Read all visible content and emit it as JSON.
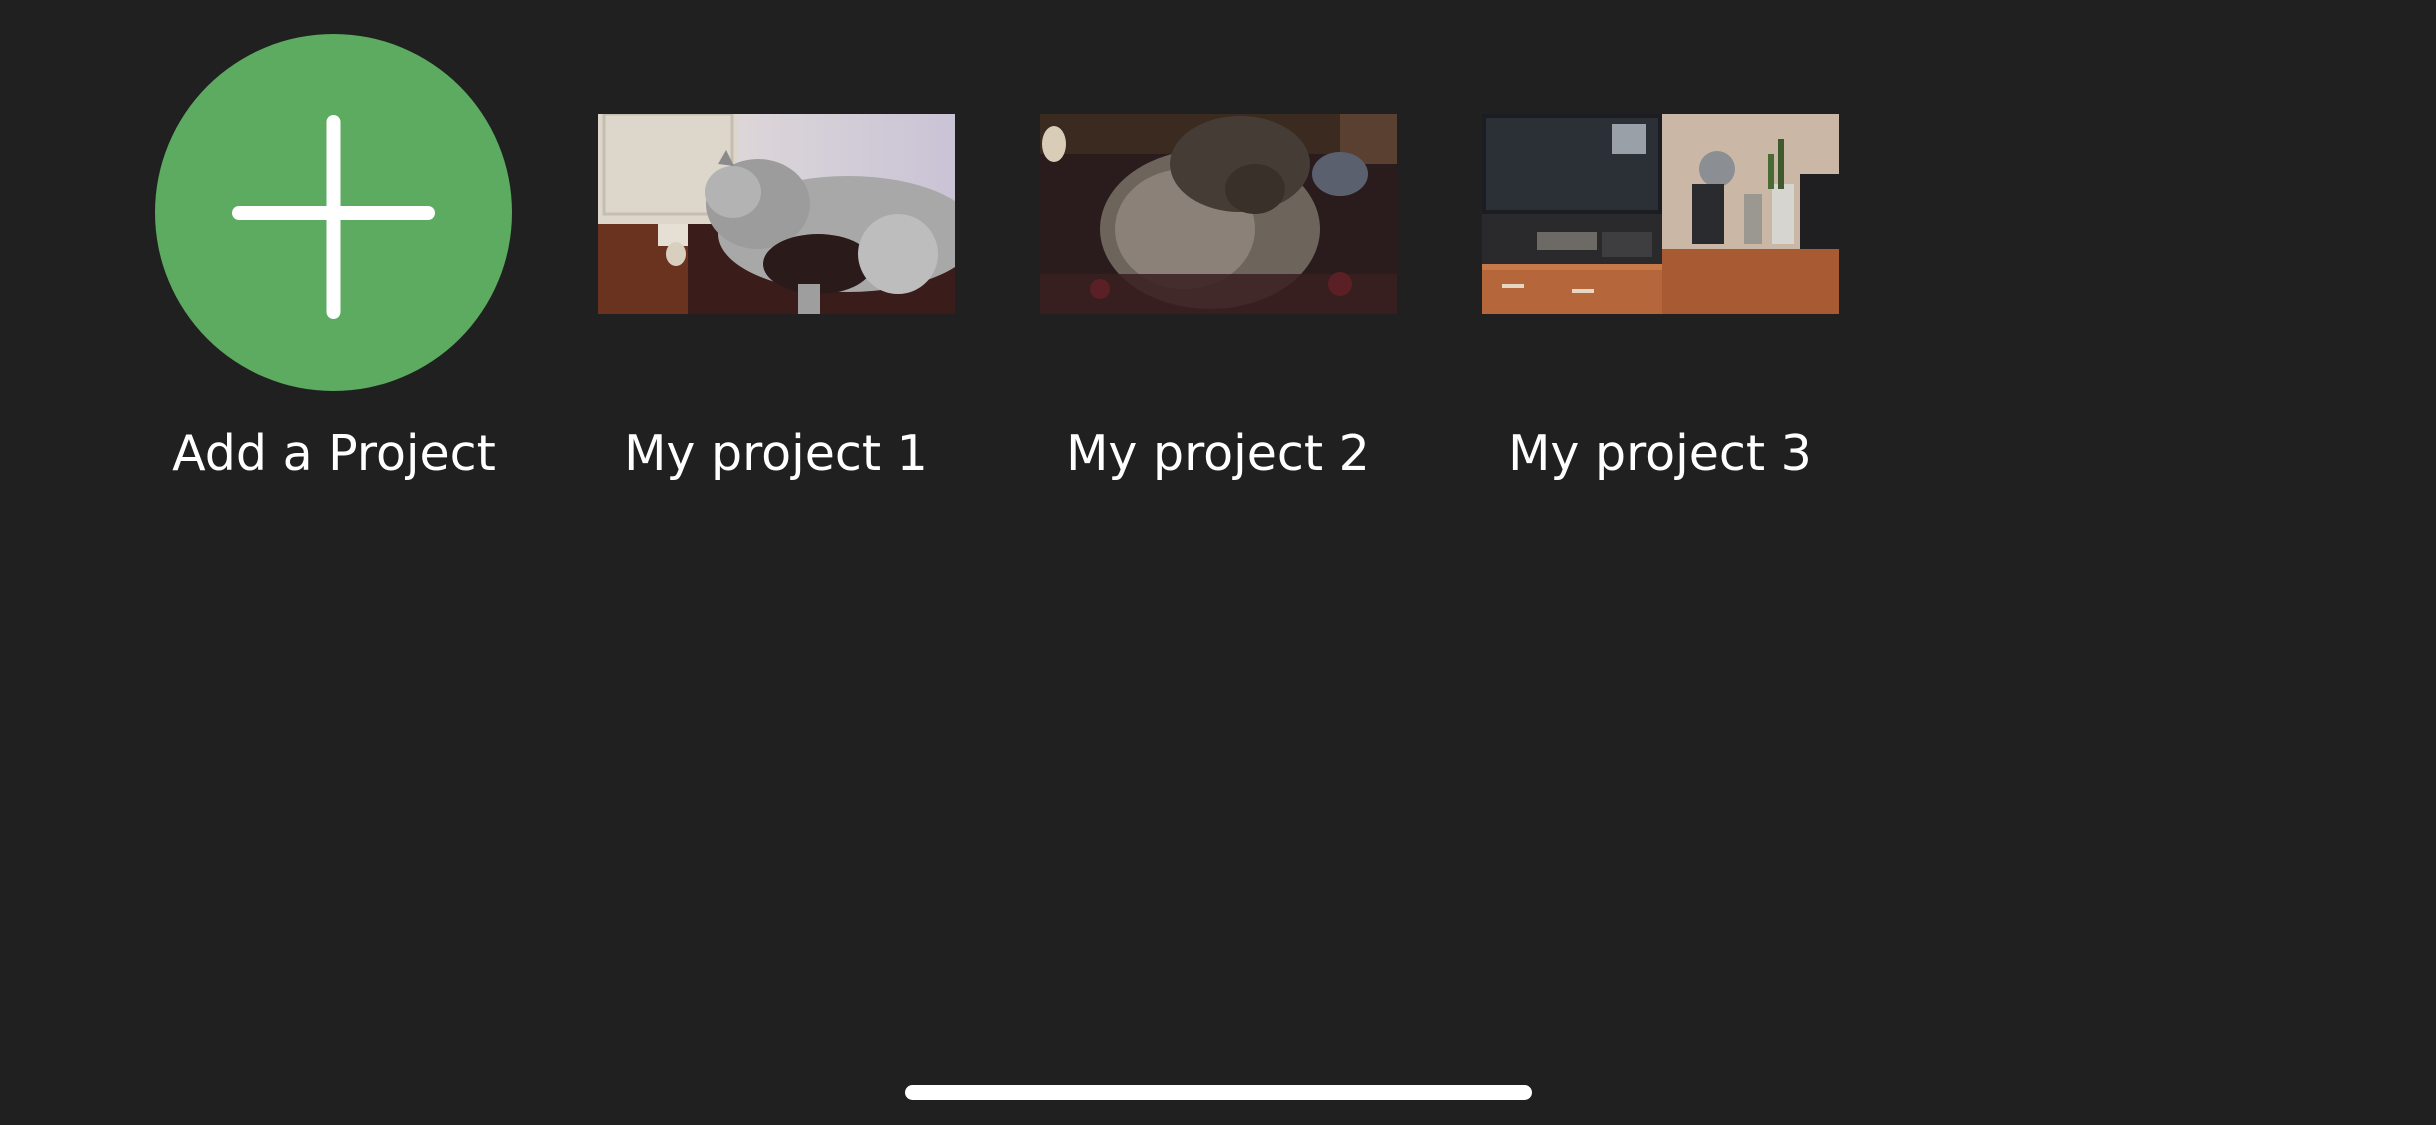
{
  "add_project": {
    "label": "Add a Project",
    "icon": "plus-icon",
    "color": "#5cab60"
  },
  "projects": [
    {
      "label": "My project 1",
      "thumbnail": "grey cat on rug near white furniture"
    },
    {
      "label": "My project 2",
      "thumbnail": "fluffy cat on dark patterned rug"
    },
    {
      "label": "My project 3",
      "thumbnail": "television on wooden cabinet with plants"
    }
  ]
}
